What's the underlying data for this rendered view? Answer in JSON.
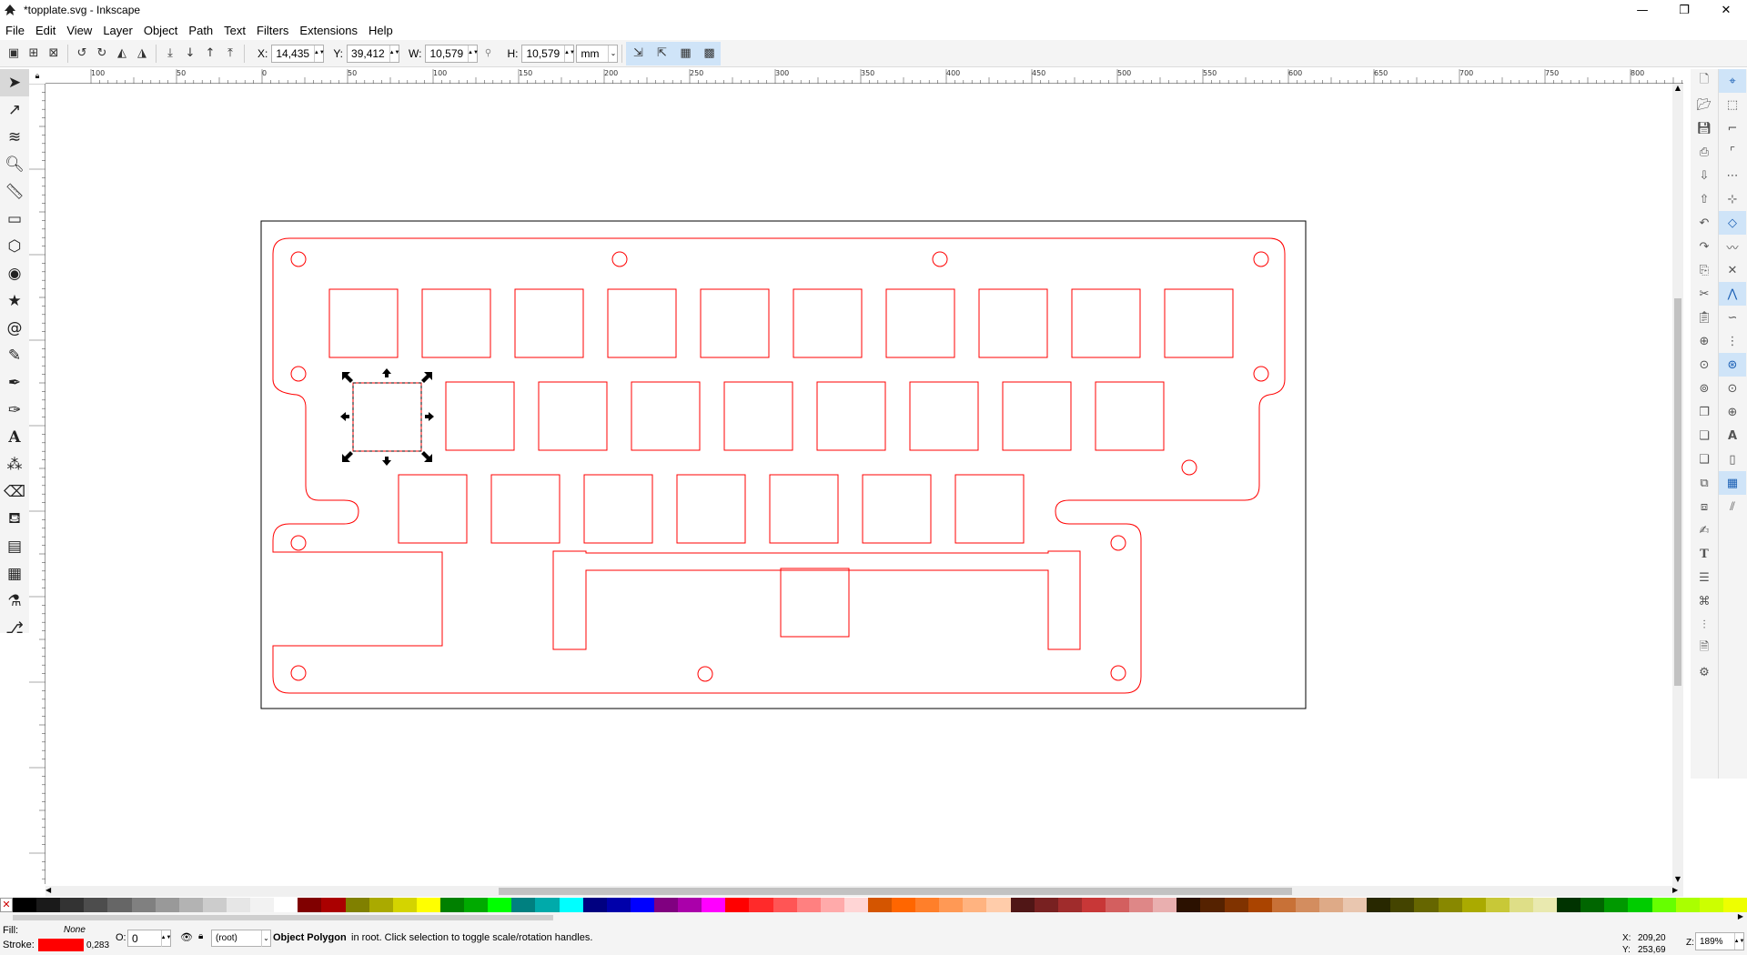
{
  "window": {
    "title": "*topplate.svg - Inkscape",
    "minimize": "—",
    "maximize": "❐",
    "close": "✕"
  },
  "menus": [
    "File",
    "Edit",
    "View",
    "Layer",
    "Object",
    "Path",
    "Text",
    "Filters",
    "Extensions",
    "Help"
  ],
  "controls": {
    "x_label": "X:",
    "x_value": "14,435",
    "y_label": "Y:",
    "y_value": "39,412",
    "w_label": "W:",
    "w_value": "10,579",
    "h_label": "H:",
    "h_value": "10,579",
    "unit": "mm"
  },
  "ruler": {
    "labels": [
      "100",
      "50",
      "0",
      "50",
      "100",
      "150",
      "200",
      "250",
      "300",
      "350",
      "400",
      "450",
      "500",
      "550",
      "600",
      "650",
      "700",
      "750",
      "800"
    ]
  },
  "status": {
    "fill_label": "Fill:",
    "fill_value": "None",
    "stroke_label": "Stroke:",
    "stroke_width": "0,283",
    "stroke_color": "#ff0000",
    "opacity_label": "O:",
    "opacity_value": "0",
    "layer": "(root)",
    "message_bold": "Object Polygon",
    "message_rest": " in root. Click selection to toggle scale/rotation handles.",
    "cursor_x_label": "X:",
    "cursor_x": "209,20",
    "cursor_y_label": "Y:",
    "cursor_y": "253,69",
    "zoom_label": "Z:",
    "zoom_value": "189%"
  },
  "colors": {
    "accent": "#1a5fb4",
    "drawing_stroke": "#ff0000"
  },
  "palette": [
    "#000000",
    "#1a1a1a",
    "#333333",
    "#4d4d4d",
    "#666666",
    "#808080",
    "#999999",
    "#b3b3b3",
    "#cccccc",
    "#e6e6e6",
    "#f2f2f2",
    "#ffffff",
    "#800000",
    "#aa0000",
    "#808000",
    "#aaaa00",
    "#d4d400",
    "#ffff00",
    "#008000",
    "#00aa00",
    "#00ff00",
    "#008080",
    "#00aaaa",
    "#00ffff",
    "#000080",
    "#0000aa",
    "#0000ff",
    "#800080",
    "#aa00aa",
    "#ff00ff",
    "#ff0000",
    "#ff2a2a",
    "#ff5555",
    "#ff8080",
    "#ffaaaa",
    "#ffd5d5",
    "#d45500",
    "#ff6600",
    "#ff7f2a",
    "#ff9955",
    "#ffb380",
    "#ffccaa",
    "#501616",
    "#782121",
    "#a02c2c",
    "#c83737",
    "#d35f5f",
    "#de8787",
    "#e9afaf",
    "#2b1100",
    "#552200",
    "#803300",
    "#aa4400",
    "#c87137",
    "#d38d5f",
    "#deaa87",
    "#e9c6af",
    "#282800",
    "#444400",
    "#666600",
    "#888800",
    "#aaaa00",
    "#c8c837",
    "#dede87",
    "#e9e9af",
    "#003300",
    "#006600",
    "#009900",
    "#00cc00",
    "#66ff00",
    "#aaff00",
    "#ccff00",
    "#eeff00"
  ]
}
